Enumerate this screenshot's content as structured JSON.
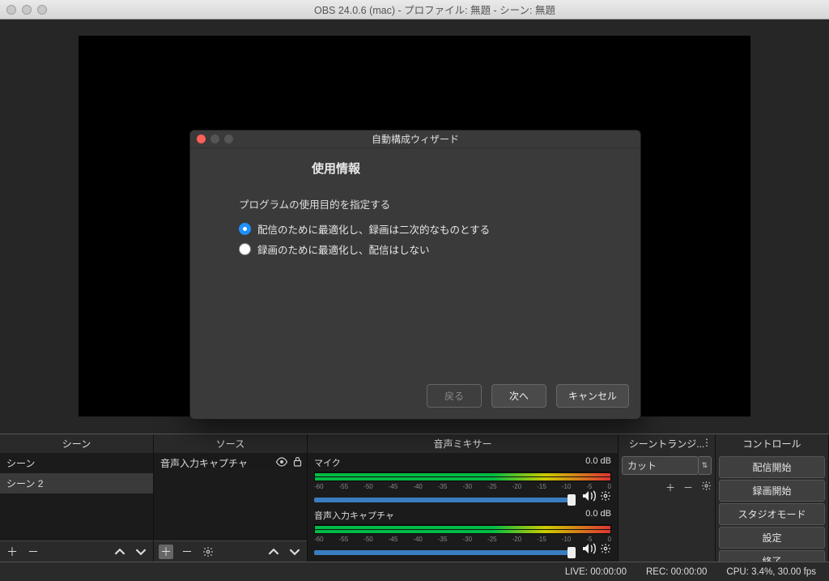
{
  "titlebar": {
    "title": "OBS 24.0.6 (mac) - プロファイル: 無題 - シーン: 無題"
  },
  "panels": {
    "scenes": {
      "title": "シーン",
      "items": [
        "シーン",
        "シーン 2"
      ],
      "selected": 1
    },
    "sources": {
      "title": "ソース",
      "items": [
        "音声入力キャプチャ"
      ]
    },
    "mixer": {
      "title": "音声ミキサー",
      "channels": [
        {
          "name": "マイク",
          "level": "0.0 dB"
        },
        {
          "name": "音声入力キャプチャ",
          "level": "0.0 dB"
        }
      ],
      "ticks": [
        "-60",
        "-55",
        "-50",
        "-45",
        "-40",
        "-35",
        "-30",
        "-25",
        "-20",
        "-15",
        "-10",
        "-5",
        "0"
      ]
    },
    "transitions": {
      "title": "シーントランジ...",
      "selected": "カット"
    },
    "controls": {
      "title": "コントロール",
      "buttons": {
        "start_stream": "配信開始",
        "start_rec": "録画開始",
        "studio": "スタジオモード",
        "settings": "設定",
        "exit": "終了"
      }
    }
  },
  "statusbar": {
    "live": "LIVE: 00:00:00",
    "rec": "REC: 00:00:00",
    "cpu": "CPU: 3.4%, 30.00 fps"
  },
  "wizard": {
    "title": "自動構成ウィザード",
    "heading": "使用情報",
    "subheading": "プログラムの使用目的を指定する",
    "opt_stream": "配信のために最適化し、録画は二次的なものとする",
    "opt_record": "録画のために最適化し、配信はしない",
    "btn_back": "戻る",
    "btn_next": "次へ",
    "btn_cancel": "キャンセル"
  }
}
